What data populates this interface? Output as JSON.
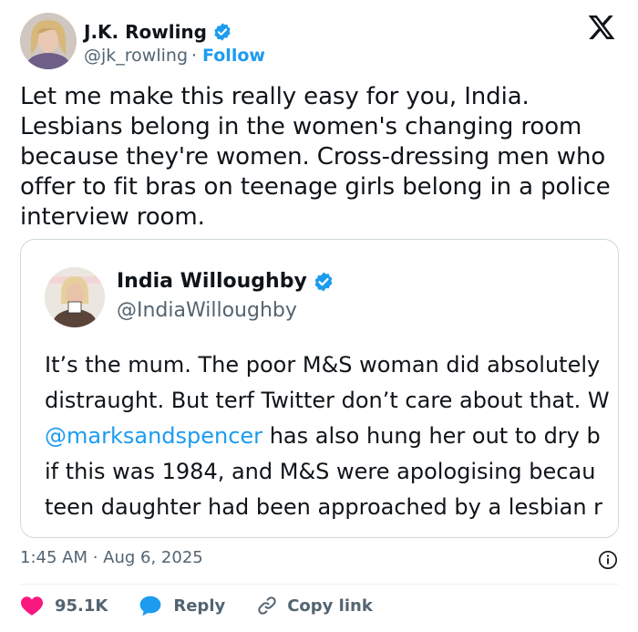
{
  "author": {
    "name": "J.K. Rowling",
    "handle": "@jk_rowling",
    "separator": "·",
    "follow_label": "Follow"
  },
  "tweet": {
    "text": "Let me make this really easy for you, India.\nLesbians belong in the women's changing room\nbecause they're women. Cross-dressing men who\noffer to fit bras on teenage girls belong in a police\ninterview room."
  },
  "quoted": {
    "name": "India Willoughby",
    "handle": "@IndiaWilloughby",
    "lines": [
      "It’s the mum. The poor M&S woman did absolutely",
      "distraught. But terf Twitter don’t care about that. W",
      "has also hung her out to dry b",
      "if this was 1984, and M&S were apologising becau",
      "teen daughter had been approached by a lesbian r"
    ],
    "mention": "@marksandspencer"
  },
  "meta": {
    "timestamp": "1:45 AM · Aug 6, 2025"
  },
  "actions": {
    "likes": "95.1K",
    "reply_label": "Reply",
    "copy_label": "Copy link"
  },
  "colors": {
    "accent": "#1d9bf0",
    "like": "#f91880",
    "muted": "#536471"
  },
  "icons": [
    "verified-badge-icon",
    "x-logo-icon",
    "info-icon",
    "heart-icon",
    "reply-bubble-icon",
    "link-icon"
  ]
}
